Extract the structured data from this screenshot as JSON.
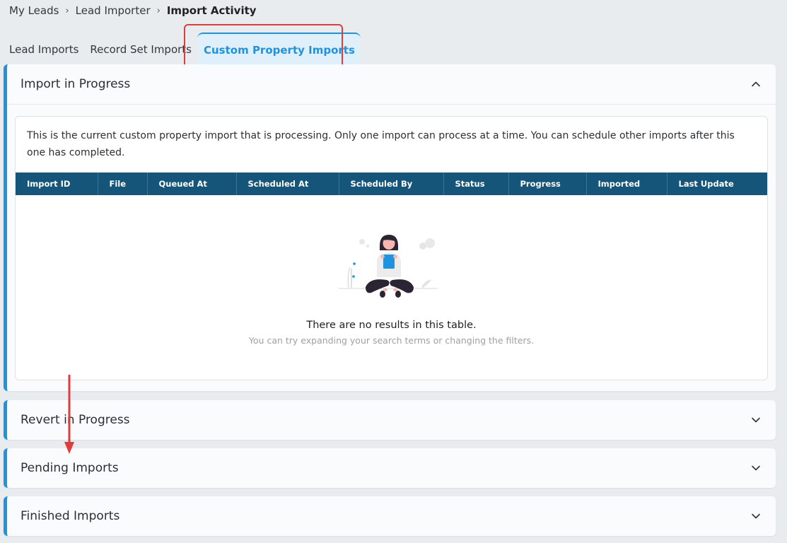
{
  "breadcrumb": {
    "items": [
      "My Leads",
      "Lead Importer"
    ],
    "current": "Import Activity"
  },
  "tabs": {
    "lead_imports": "Lead Imports",
    "record_set_imports": "Record Set Imports",
    "custom_property_imports": "Custom Property Imports"
  },
  "panels": {
    "import_in_progress": {
      "title": "Import in Progress",
      "description": "This is the current custom property import that is processing. Only one import can process at a time. You can schedule other imports after this one has completed.",
      "columns": [
        "Import ID",
        "File",
        "Queued At",
        "Scheduled At",
        "Scheduled By",
        "Status",
        "Progress",
        "Imported",
        "Last Update"
      ],
      "empty_title": "There are no results in this table.",
      "empty_subtitle": "You can try expanding your search terms or changing the filters."
    },
    "revert_in_progress": {
      "title": "Revert in Progress"
    },
    "pending_imports": {
      "title": "Pending Imports"
    },
    "finished_imports": {
      "title": "Finished Imports"
    }
  },
  "icons": {
    "chevron_up": "chevron-up-icon",
    "chevron_down": "chevron-down-icon",
    "breadcrumb_separator": "chevron-right-icon"
  },
  "colors": {
    "accent": "#1e93e0",
    "table_header": "#15557a",
    "annotation": "#e23b3b"
  }
}
